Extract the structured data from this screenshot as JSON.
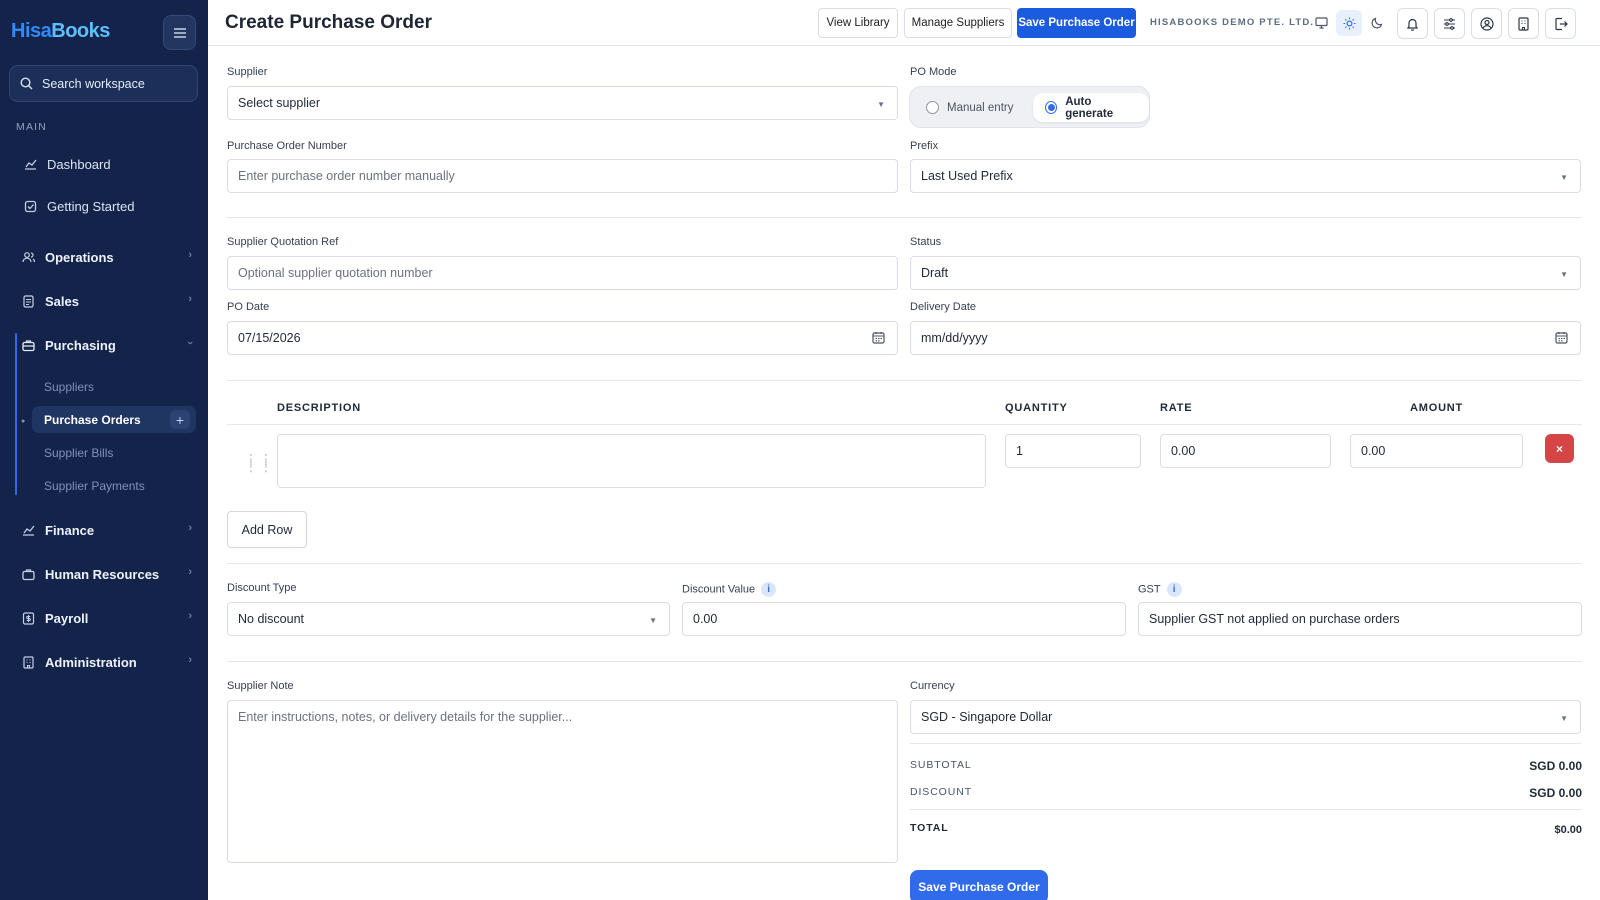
{
  "brand": {
    "part1": "Hisa",
    "part2": "Books"
  },
  "sidebar": {
    "search_placeholder": "Search workspace",
    "section_main": "MAIN",
    "items": [
      {
        "label": "Dashboard",
        "icon": "chart-line-icon"
      },
      {
        "label": "Getting Started",
        "icon": "checklist-icon"
      },
      {
        "label": "Operations",
        "icon": "users-icon"
      },
      {
        "label": "Sales",
        "icon": "document-icon"
      },
      {
        "label": "Purchasing",
        "icon": "briefcase-icon"
      },
      {
        "label": "Finance",
        "icon": "chart-line-icon"
      },
      {
        "label": "Human Resources",
        "icon": "briefcase-icon"
      },
      {
        "label": "Payroll",
        "icon": "dollar-book-icon"
      },
      {
        "label": "Administration",
        "icon": "building-icon"
      }
    ],
    "purchasing_sub": [
      "Suppliers",
      "Purchase Orders",
      "Supplier Bills",
      "Supplier Payments"
    ]
  },
  "header": {
    "title": "Create Purchase Order",
    "view_library": "View Library",
    "manage_suppliers": "Manage Suppliers",
    "save_po": "Save Purchase Order",
    "company": "HISABOOKS DEMO PTE. LTD."
  },
  "form": {
    "supplier_label": "Supplier",
    "supplier_value": "Select supplier",
    "po_mode_label": "PO Mode",
    "mode_manual": "Manual entry",
    "mode_auto": "Auto generate",
    "po_number_label": "Purchase Order Number",
    "po_number_placeholder": "Enter purchase order number manually",
    "prefix_label": "Prefix",
    "prefix_value": "Last Used Prefix",
    "quotation_label": "Supplier Quotation Ref",
    "quotation_placeholder": "Optional supplier quotation number",
    "status_label": "Status",
    "status_value": "Draft",
    "po_date_label": "PO Date",
    "po_date_value": "07/15/2026",
    "delivery_date_label": "Delivery Date",
    "delivery_date_value": "mm/dd/yyyy"
  },
  "items": {
    "headers": {
      "description": "DESCRIPTION",
      "quantity": "QUANTITY",
      "rate": "RATE",
      "amount": "AMOUNT"
    },
    "rows": [
      {
        "description": "",
        "quantity": "1",
        "rate": "0.00",
        "amount": "0.00"
      }
    ],
    "delete_label": "×",
    "add_row": "Add Row"
  },
  "discount": {
    "type_label": "Discount Type",
    "type_value": "No discount",
    "value_label": "Discount Value",
    "value": "0.00",
    "gst_label": "GST",
    "gst_value": "Supplier GST not applied on purchase orders",
    "info_glyph": "i"
  },
  "note": {
    "label": "Supplier Note",
    "placeholder": "Enter instructions, notes, or delivery details for the supplier..."
  },
  "currency": {
    "label": "Currency",
    "value": "SGD - Singapore Dollar"
  },
  "totals": {
    "subtotal_label": "SUBTOTAL",
    "subtotal_value": "SGD 0.00",
    "discount_label": "DISCOUNT",
    "discount_value": "SGD 0.00",
    "total_label": "TOTAL",
    "total_value": "$0.00"
  },
  "save_bottom": "Save Purchase Order",
  "colors": {
    "sidebar_bg": "#13234a",
    "primary": "#1b5cde",
    "danger": "#d64545"
  }
}
